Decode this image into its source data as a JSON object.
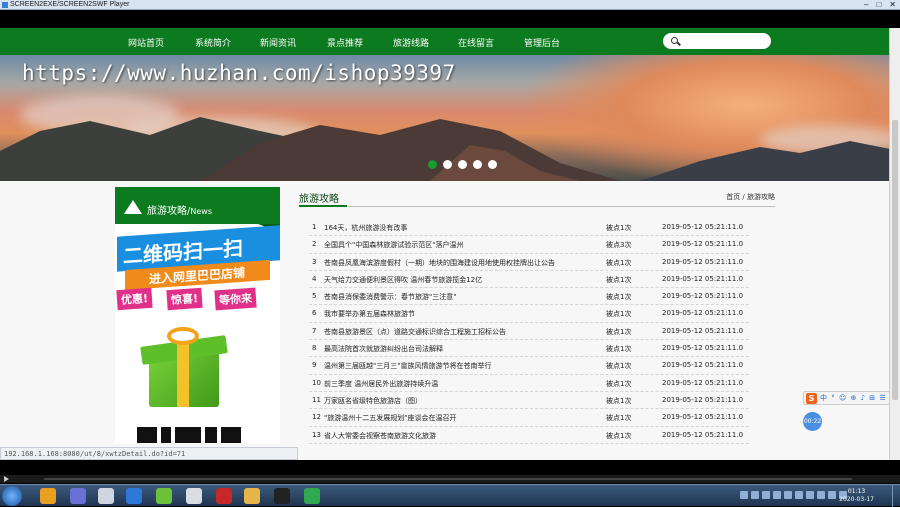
{
  "window": {
    "title": "SCREEN2EXE/SCREEN2SWF Player",
    "buttons": [
      "–",
      "□",
      "✕"
    ]
  },
  "nav": {
    "items": [
      "网站首页",
      "系统简介",
      "新闻资讯",
      "景点推荐",
      "旅游线路",
      "在线留言",
      "管理后台"
    ],
    "search_placeholder": ""
  },
  "banner": {
    "watermark": "https://www.huzhan.com/ishop39397",
    "slide_count": 5,
    "active_slide": 1
  },
  "promo": {
    "header_title": "旅游攻略/",
    "header_sub": "News",
    "qr_text": "二维码扫一扫",
    "store_text": "进入网里巴巴店铺",
    "tags": [
      "优惠!",
      "惊喜!",
      "等你来"
    ]
  },
  "content": {
    "title": "旅游攻略",
    "breadcrumb": "首页 / 旅游攻略",
    "rows": [
      {
        "num": "1",
        "title": "164天，杭州旅游没有改事",
        "clicks": "被点1次",
        "date": "2019-05-12 05:21:11.0"
      },
      {
        "num": "2",
        "title": "全国具个\"中国森林旅游试验示范区\"落户温州",
        "clicks": "被点3次",
        "date": "2019-05-12 05:21:11.0"
      },
      {
        "num": "3",
        "title": "苍南县凤凰海滨游度假村（一期）地块的围海建设用地使用权挂牌出让公告",
        "clicks": "被点1次",
        "date": "2019-05-12 05:21:11.0"
      },
      {
        "num": "4",
        "title": "天气给力交通便利景区得吹 温州春节旅游揽金12亿",
        "clicks": "被点1次",
        "date": "2019-05-12 05:21:11.0"
      },
      {
        "num": "5",
        "title": "苍南县消保委消费警示：春节旅游\"三注意\"",
        "clicks": "被点1次",
        "date": "2019-05-12 05:21:11.0"
      },
      {
        "num": "6",
        "title": "我市要举办第五届森林旅游节",
        "clicks": "被点1次",
        "date": "2019-05-12 05:21:11.0"
      },
      {
        "num": "7",
        "title": "苍南县旅游景区（点）道路交通标识综合工程施工招标公告",
        "clicks": "被点1次",
        "date": "2019-05-12 05:21:11.0"
      },
      {
        "num": "8",
        "title": "最高法院首次就旅游纠纷出台司法解释",
        "clicks": "被点1次",
        "date": "2019-05-12 05:21:11.0"
      },
      {
        "num": "9",
        "title": "温州第三届瓯越\"三月三\"畲族风情旅游节将在苍南举行",
        "clicks": "被点1次",
        "date": "2019-05-12 05:21:11.0"
      },
      {
        "num": "10",
        "title": "前三季度 温州居民外出旅游持续升温",
        "clicks": "被点1次",
        "date": "2019-05-12 05:21:11.0"
      },
      {
        "num": "11",
        "title": "万家瓯名省级特色旅游店（图）",
        "clicks": "被点1次",
        "date": "2019-05-12 05:21:11.0"
      },
      {
        "num": "12",
        "title": "\"旅游温州十二五发展规划\"座谈会在温召开",
        "clicks": "被点1次",
        "date": "2019-05-12 05:21:11.0"
      },
      {
        "num": "13",
        "title": "省人大常委会视察苍南旅游文化旅游",
        "clicks": "被点1次",
        "date": "2019-05-12 05:21:11.0"
      }
    ]
  },
  "statusbar": {
    "url": "192.168.1.168:8080/ut/8/xwtzDetail.do?id=71"
  },
  "ime": {
    "logo": "S",
    "icons": "中 ° ☺ ⊕ ♪ ⊞ ☰ ⋯"
  },
  "bubble": {
    "text": "00:22"
  },
  "taskbar": {
    "clock_time": "01:13",
    "clock_date": "2020-03-17"
  }
}
